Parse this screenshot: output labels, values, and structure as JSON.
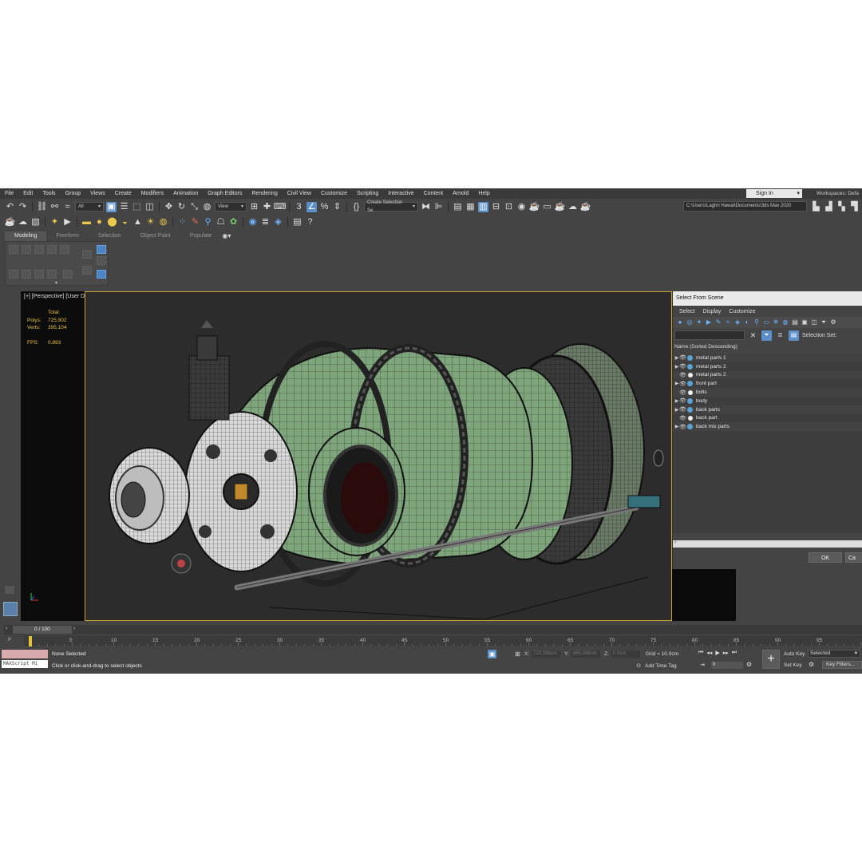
{
  "menubar": {
    "items": [
      "File",
      "Edit",
      "Tools",
      "Group",
      "Views",
      "Create",
      "Modifiers",
      "Animation",
      "Graph Editors",
      "Rendering",
      "Civil View",
      "Customize",
      "Scripting",
      "Interactive",
      "Content",
      "Arnold",
      "Help"
    ],
    "sign_in": "Sign In",
    "workspaces_label": "Workspaces:",
    "workspaces_value": "Defa"
  },
  "toolbar": {
    "filter_all": "All",
    "view": "View",
    "create_selection_set": "Create Selection Se",
    "project_path": "C:\\Users\\Laghri Hawai\\Documents\\3ds Max 2020"
  },
  "ribbon": {
    "tabs": [
      "Modeling",
      "Freeform",
      "Selection",
      "Object Paint",
      "Populate"
    ],
    "active_tab": "Modeling"
  },
  "viewport": {
    "label": "[+] [Perspective] [User Defined] [Edged Faces]  <<Disabled>>",
    "stats": {
      "total_label": "Total",
      "polys_label": "Polys:",
      "polys": "725,902",
      "verts_label": "Verts:",
      "verts": "395,104",
      "fps_label": "FPS:",
      "fps": "0.893"
    }
  },
  "select_from_scene": {
    "title": "Select From Scene",
    "menu": [
      "Select",
      "Display",
      "Customize"
    ],
    "selection_set_label": "Selection Set:",
    "column_header": "Name (Sorted Descending)",
    "items": [
      {
        "label": "metal parts 1",
        "expandable": true,
        "type": "group"
      },
      {
        "label": "metal  parts 2",
        "expandable": true,
        "type": "group"
      },
      {
        "label": "metal parts 2",
        "expandable": false,
        "type": "mesh"
      },
      {
        "label": "front part",
        "expandable": true,
        "type": "group"
      },
      {
        "label": "bolts",
        "expandable": false,
        "type": "mesh"
      },
      {
        "label": "body",
        "expandable": true,
        "type": "group"
      },
      {
        "label": "back parts",
        "expandable": true,
        "type": "group"
      },
      {
        "label": "back part",
        "expandable": false,
        "type": "mesh"
      },
      {
        "label": "back mix parts",
        "expandable": true,
        "type": "group"
      }
    ],
    "ok": "OK",
    "cancel": "Ca"
  },
  "timeline": {
    "frame": "0 / 100",
    "ticks": [
      "5",
      "10",
      "15",
      "20",
      "25",
      "30",
      "35",
      "40",
      "45",
      "50",
      "55",
      "60",
      "65",
      "70",
      "75",
      "80",
      "85",
      "90",
      "95"
    ],
    "current_frame": 0,
    "total_frames": 100
  },
  "status": {
    "maxscript": "MAXScript Mi",
    "selection": "None Selected",
    "prompt": "Click or click-and-drag to select objects",
    "x_label": "X:",
    "x": "722.098cm",
    "y_label": "Y:",
    "y": "665.098cm",
    "z_label": "Z:",
    "z": "0.0cm",
    "grid": "Grid = 10.0cm",
    "add_time_tag": "Add Time Tag",
    "key_frame": "0",
    "auto_key": "Auto Key",
    "set_key": "Set Key",
    "selected": "Selected",
    "key_filters": "Key Filters..."
  },
  "colors": {
    "accent": "#5a8fc7",
    "viewport_border": "#c9a530",
    "stats_text": "#e7c23c",
    "model_green": "#7fa57c"
  }
}
